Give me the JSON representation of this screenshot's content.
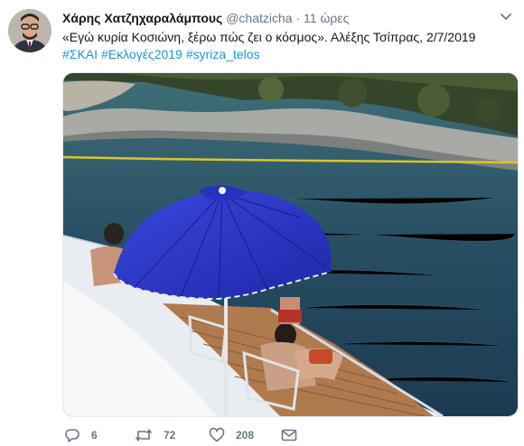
{
  "tweet": {
    "author_name": "Χάρης Χατζηχαραλάμπους",
    "handle": "@chatzicha",
    "separator": "·",
    "time": "11 ώρες",
    "text": "«Εγώ κυρία Κοσιώνη, ξέρω πώς ζει ο κόσμος». Αλέξης Τσίπρας, 2/7/2019",
    "hashtags": [
      "#ΣΚΑΙ",
      "#Εκλογές2019",
      "#syriza_telos"
    ]
  },
  "actions": {
    "reply_count": "6",
    "retweet_count": "72",
    "like_count": "208"
  },
  "icons": {
    "caret": "chevron-down-icon",
    "reply": "reply-icon",
    "retweet": "retweet-icon",
    "like": "heart-icon",
    "dm": "envelope-icon"
  },
  "colors": {
    "link": "#1b95e0",
    "secondary": "#657786",
    "umbrella": "#2a36c9"
  }
}
